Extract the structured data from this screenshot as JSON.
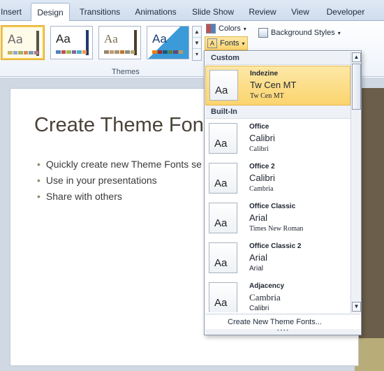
{
  "tabs": [
    "Insert",
    "Design",
    "Transitions",
    "Animations",
    "Slide Show",
    "Review",
    "View",
    "Developer"
  ],
  "active_tab": "Design",
  "ribbon": {
    "theme_thumb_label": "Aa",
    "themes_group_label": "Themes",
    "colors_label": "Colors",
    "fonts_label": "Fonts",
    "background_styles_label": "Background Styles"
  },
  "slide": {
    "title": "Create Theme Fonts",
    "bullets": [
      "Quickly create new Theme Fonts se",
      "Use in your presentations",
      "Share with others"
    ]
  },
  "fonts_menu": {
    "custom_header": "Custom",
    "builtin_header": "Built-In",
    "thumb_text": "Aa",
    "custom": [
      {
        "name": "Indezine",
        "heading": "Tw Cen MT",
        "body": "Tw Cen MT"
      }
    ],
    "builtin": [
      {
        "name": "Office",
        "heading": "Calibri",
        "body": "Calibri"
      },
      {
        "name": "Office 2",
        "heading": "Calibri",
        "body": "Cambria"
      },
      {
        "name": "Office Classic",
        "heading": "Arial",
        "body": "Times New Roman"
      },
      {
        "name": "Office Classic 2",
        "heading": "Arial",
        "body": "Arial"
      },
      {
        "name": "Adjacency",
        "heading": "Cambria",
        "body": "Calibri"
      }
    ],
    "footer_action": "Create New Theme Fonts..."
  },
  "colors": {
    "selected_highlight": "#fbd46e",
    "ribbon_bg": "#eef3fa",
    "slide_title_color": "#4a4238",
    "band_brown": "#6b5e4a",
    "band_olive": "#b8ac78"
  }
}
